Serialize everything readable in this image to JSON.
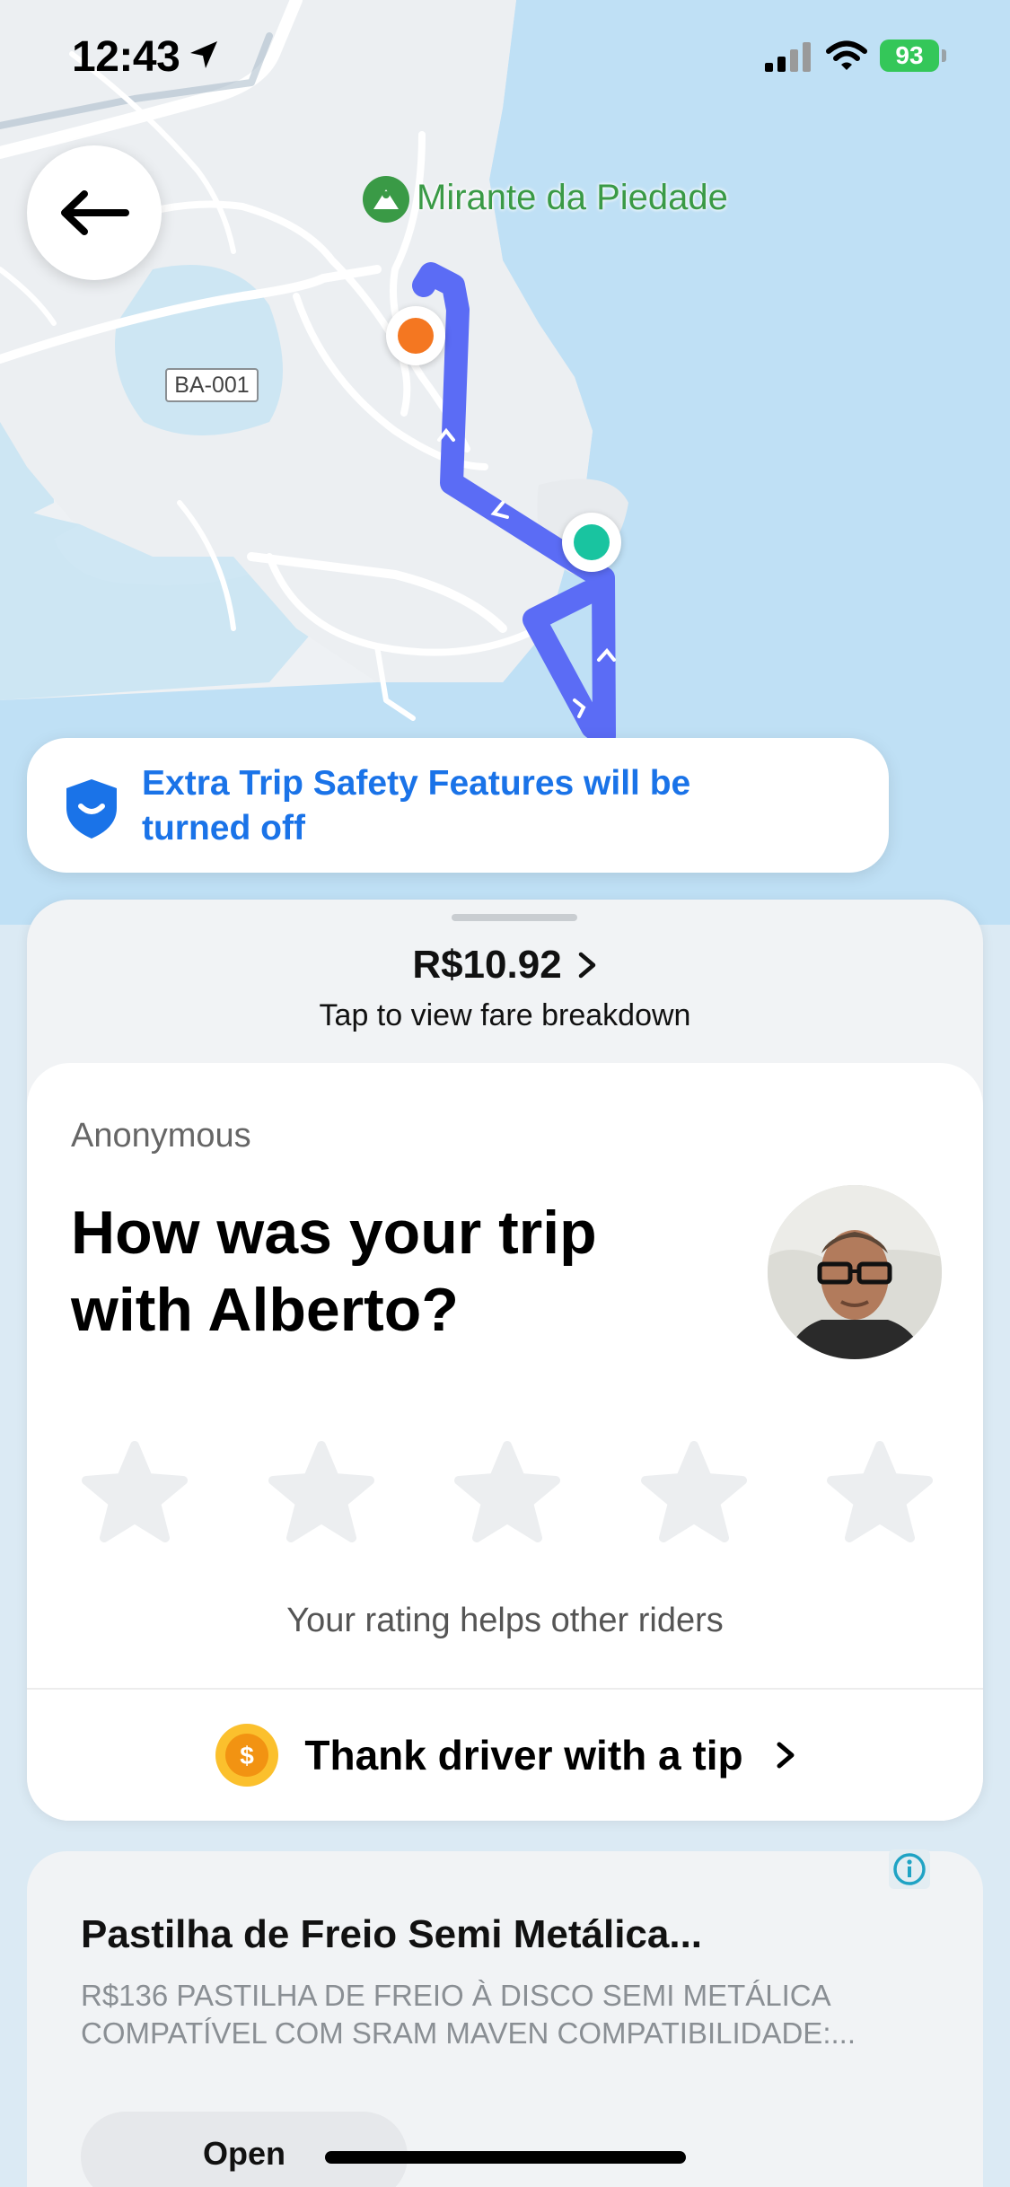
{
  "status_bar": {
    "time": "12:43",
    "battery": "93"
  },
  "map": {
    "poi_label": "Mirante da Piedade",
    "road_label": "BA-001",
    "route_color": "#5b6cf5",
    "pickup_color": "#f47721",
    "dropoff_color": "#19c4a0"
  },
  "safety_banner": {
    "text": "Extra Trip Safety Features will be turned off",
    "color": "#1a73e8"
  },
  "fare": {
    "amount": "R$10.92",
    "hint": "Tap to view fare breakdown"
  },
  "rating": {
    "rater": "Anonymous",
    "question": "How was your trip with Alberto?",
    "stars_total": 5,
    "stars_selected": 0,
    "hint": "Your rating helps other riders"
  },
  "tip": {
    "label": "Thank driver with a tip",
    "coin_symbol": "$"
  },
  "ad": {
    "title": "Pastilha de Freio Semi Metálica...",
    "description": "R$136 PASTILHA DE FREIO À DISCO SEMI METÁLICA COMPATÍVEL COM SRAM MAVEN COMPATIBILIDADE:...",
    "open_label": "Open"
  },
  "icons": {
    "back": "arrow-left-icon",
    "shield": "shield-icon",
    "info": "info-icon",
    "coin": "coin-icon"
  }
}
